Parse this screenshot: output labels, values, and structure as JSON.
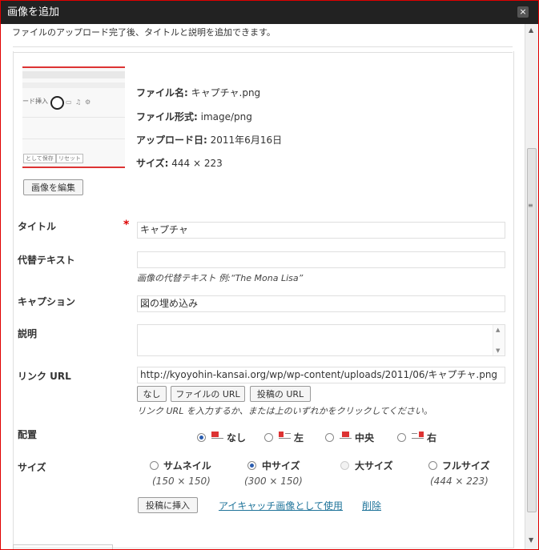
{
  "dialog": {
    "title": "画像を追加",
    "close_label": "×"
  },
  "intro": "ファイルのアップロード完了後、タイトルと説明を追加できます。",
  "thumbnail": {
    "toolbar_text": "ード挿入",
    "btn_save": "として保存",
    "btn_reset": "リセット"
  },
  "file_info": {
    "name_label": "ファイル名:",
    "name_value": "キャプチャ.png",
    "type_label": "ファイル形式:",
    "type_value": "image/png",
    "date_label": "アップロード日:",
    "date_value": "2011年6月16日",
    "size_label": "サイズ:",
    "size_value": "444 × 223"
  },
  "edit_image_button": "画像を編集",
  "fields": {
    "title_label": "タイトル",
    "required_mark": "*",
    "title_value": "キャプチャ",
    "alt_label": "代替テキスト",
    "alt_value": "",
    "alt_help": "画像の代替テキスト 例:“The Mona Lisa”",
    "caption_label": "キャプション",
    "caption_value": "図の埋め込み",
    "desc_label": "説明",
    "desc_value": "",
    "link_label": "リンク URL",
    "link_value": "http://kyoyohin-kansai.org/wp/wp-content/uploads/2011/06/キャプチャ.png",
    "link_help": "リンク URL を入力するか、または上のいずれかをクリックしてください。"
  },
  "link_buttons": {
    "none": "なし",
    "file_url": "ファイルの URL",
    "post_url": "投稿の URL"
  },
  "alignment": {
    "label": "配置",
    "options": [
      "なし",
      "左",
      "中央",
      "右"
    ],
    "selected": "なし"
  },
  "size": {
    "label": "サイズ",
    "options": [
      {
        "name": "サムネイル",
        "dims": "(150 × 150)"
      },
      {
        "name": "中サイズ",
        "dims": "(300 × 150)"
      },
      {
        "name": "大サイズ",
        "dims": ""
      },
      {
        "name": "フルサイズ",
        "dims": "(444 × 223)"
      }
    ],
    "selected": "中サイズ"
  },
  "actions": {
    "insert": "投稿に挿入",
    "featured": "アイキャッチ画像として使用",
    "delete": "削除"
  },
  "colors": {
    "titlebar": "#222222",
    "frame_border": "#e00000",
    "link": "#21759b",
    "required": "#dd0000"
  }
}
